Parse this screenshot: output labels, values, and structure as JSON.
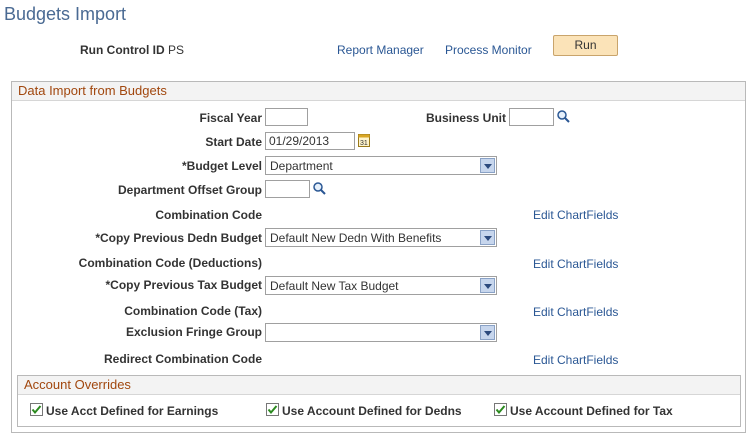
{
  "page_title": "Budgets Import",
  "header": {
    "run_control_label": "Run Control ID",
    "run_control_value": "PS",
    "report_manager": "Report Manager",
    "process_monitor": "Process Monitor",
    "run_button": "Run"
  },
  "section": {
    "title": "Data Import from Budgets",
    "fiscal_year_label": "Fiscal Year",
    "fiscal_year_value": "",
    "business_unit_label": "Business Unit",
    "business_unit_value": "",
    "start_date_label": "Start Date",
    "start_date_value": "01/29/2013",
    "budget_level_label": "*Budget Level",
    "budget_level_value": "Department",
    "dept_offset_label": "Department Offset Group",
    "dept_offset_value": "",
    "combination_code_label": "Combination Code",
    "edit_chartfields_1": "Edit ChartFields",
    "copy_dedn_label": "*Copy Previous Dedn Budget",
    "copy_dedn_value": "Default New Dedn With Benefits",
    "combination_code_dedn_label": "Combination Code (Deductions)",
    "edit_chartfields_2": "Edit ChartFields",
    "copy_tax_label": "*Copy Previous Tax Budget",
    "copy_tax_value": "Default New Tax Budget",
    "combination_code_tax_label": "Combination Code (Tax)",
    "edit_chartfields_3": "Edit ChartFields",
    "exclusion_fringe_label": "Exclusion Fringe Group",
    "exclusion_fringe_value": "",
    "redirect_label": "Redirect Combination Code",
    "edit_chartfields_4": "Edit ChartFields"
  },
  "account_overrides": {
    "title": "Account Overrides",
    "earnings": "Use Acct Defined for Earnings",
    "dedns": "Use Account Defined for Dedns",
    "tax": "Use Account Defined for Tax"
  }
}
